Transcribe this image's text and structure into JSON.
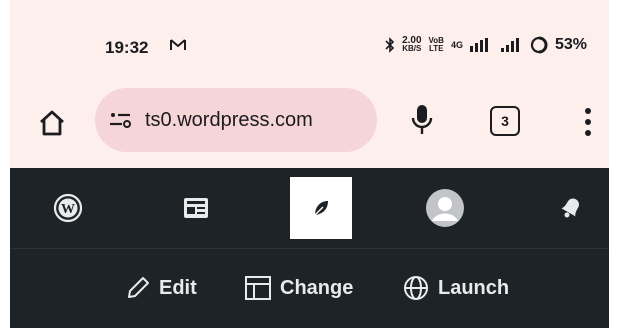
{
  "status_bar": {
    "time": "19:32",
    "speed_top": "2.00",
    "speed_bottom": "KB/S",
    "volte_top": "VoB",
    "volte_bottom": "LTE",
    "network": "4G",
    "battery": "53%"
  },
  "browser": {
    "url": "ts0.wordpress.com",
    "tab_count": "3"
  },
  "admin_bar": {
    "actions": {
      "edit": "Edit",
      "change": "Change",
      "launch": "Launch"
    }
  },
  "colors": {
    "chrome_bg": "#fcefec",
    "url_pill": "#f5d5d7",
    "admin_bg": "#1e2327",
    "admin_text": "#e8eaeb"
  }
}
